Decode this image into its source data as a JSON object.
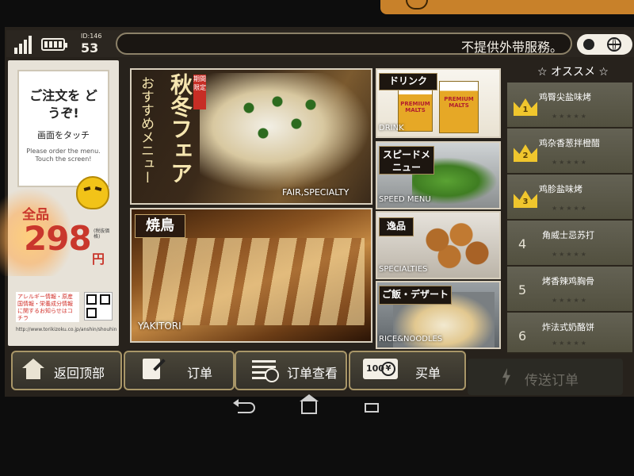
{
  "status": {
    "id_label": "ID:146",
    "table_number": "53",
    "marquee_text": "不提供外带服務。"
  },
  "left_panel": {
    "welcome_title": "ご注文を どうぞ!",
    "welcome_subtitle": "画面をタッチ",
    "welcome_english": "Please order the menu. Touch the screen!",
    "all_items_label": "全品",
    "price": "298",
    "currency": "円",
    "price_note": "(税抜価格)",
    "allergy_text": "アレルギー情報・原産国情報・栄養成分情報に関するお知らせはコチラ",
    "url": "http://www.torikizoku.co.jp/anshin/shouhin"
  },
  "tiles": {
    "fair": {
      "badge": "期間限定",
      "title": "秋冬フェア",
      "subtitle": "おすすめメニュー",
      "label": "FAIR,SPECIALTY"
    },
    "yakitori": {
      "title": "焼鳥",
      "label": "YAKITORI"
    },
    "drink": {
      "title": "ドリンク",
      "label": "DRINK",
      "beer_brand": "PREMIUM MALTS"
    },
    "speed": {
      "title": "スピードメニュー",
      "label": "SPEED MENU"
    },
    "specials": {
      "title": "逸品",
      "label": "SPECIALTIES"
    },
    "rice": {
      "title": "ご飯・デザート",
      "label": "RICE&NOODLES"
    }
  },
  "ranking": {
    "header": "☆ オススメ ☆",
    "items": [
      {
        "rank": "1",
        "name": "鸡臀尖盐味烤",
        "stars": "★★★★★"
      },
      {
        "rank": "2",
        "name": "鸡杂香葱拌橙醋",
        "stars": "★★★★★"
      },
      {
        "rank": "3",
        "name": "鸡胗盐味烤",
        "stars": "★★★★★"
      },
      {
        "rank": "4",
        "name": "角威士忌苏打",
        "stars": "★★★★★"
      },
      {
        "rank": "5",
        "name": "烤香辣鸡胸骨",
        "stars": "★★★★★"
      },
      {
        "rank": "6",
        "name": "炸法式奶酪饼",
        "stars": "★★★★★"
      }
    ]
  },
  "buttons": {
    "home": "返回顶部",
    "order": "订单",
    "order_history": "订单查看",
    "checkout": "买单",
    "checkout_icon_text": "100",
    "checkout_icon_symbol": "¥",
    "send_order": "传送订单"
  },
  "colors": {
    "accent_gold": "#a89668",
    "price_red": "#c9372c",
    "rank_bg": "#5a584a"
  }
}
